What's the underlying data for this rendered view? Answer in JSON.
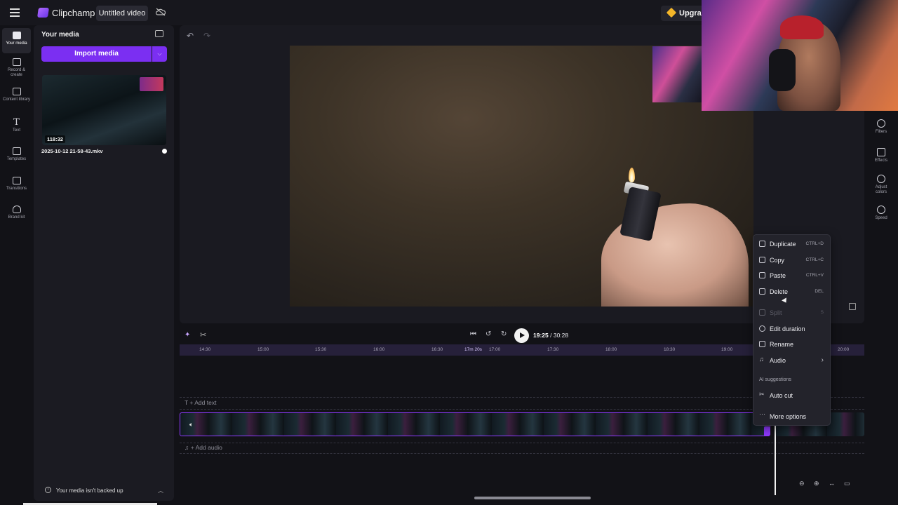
{
  "topbar": {
    "app_name": "Clipchamp",
    "project_title": "Untitled video",
    "upgrade_label": "Upgrade"
  },
  "rail": {
    "items": [
      {
        "label": "Your media",
        "icon": "folder-icon"
      },
      {
        "label": "Record & create",
        "icon": "camera-icon"
      },
      {
        "label": "Content library",
        "icon": "library-icon"
      },
      {
        "label": "Text",
        "icon": "text-icon"
      },
      {
        "label": "Templates",
        "icon": "templates-icon"
      },
      {
        "label": "Transitions",
        "icon": "transitions-icon"
      },
      {
        "label": "Brand kit",
        "icon": "brand-kit-icon"
      }
    ]
  },
  "media_panel": {
    "title": "Your media",
    "import_label": "Import media",
    "item": {
      "duration": "118:32",
      "file_name": "2025-10-12 21-58-43.mkv"
    },
    "backup_text": "Your media isn't backed up"
  },
  "right_rail": {
    "items": [
      {
        "label": "Filters",
        "icon": "filters-icon"
      },
      {
        "label": "Effects",
        "icon": "effects-icon"
      },
      {
        "label": "Adjust colors",
        "icon": "adjust-colors-icon"
      },
      {
        "label": "Speed",
        "icon": "speed-icon"
      }
    ]
  },
  "timeline": {
    "current_time": "19:25",
    "total_time": "30:28",
    "ruler_ticks": [
      "14:30",
      "15:00",
      "15:30",
      "16:00",
      "16:30",
      "17:00",
      "17:30",
      "18:00",
      "18:30",
      "19:00",
      "20:00"
    ],
    "playhead_label": "17m 20s",
    "add_text": "+ Add text",
    "add_audio": "+ Add audio"
  },
  "context_menu": {
    "items": [
      {
        "label": "Duplicate",
        "shortcut": "CTRL+D",
        "icon": "duplicate-icon",
        "enabled": true
      },
      {
        "label": "Copy",
        "shortcut": "CTRL+C",
        "icon": "copy-icon",
        "enabled": true
      },
      {
        "label": "Paste",
        "shortcut": "CTRL+V",
        "icon": "paste-icon",
        "enabled": true
      },
      {
        "label": "Delete",
        "shortcut": "DEL",
        "icon": "trash-icon",
        "enabled": true
      },
      {
        "label": "Split",
        "shortcut": "S",
        "icon": "split-icon",
        "enabled": false
      },
      {
        "label": "Edit duration",
        "shortcut": "",
        "icon": "clock-icon",
        "enabled": true
      },
      {
        "label": "Rename",
        "shortcut": "",
        "icon": "rename-icon",
        "enabled": true
      },
      {
        "label": "Audio",
        "shortcut": "",
        "icon": "music-note-icon",
        "enabled": true
      }
    ],
    "section_label": "AI suggestions",
    "auto_cut": "Auto cut",
    "more_options": "More options"
  },
  "colors": {
    "accent": "#7b2ff2",
    "panel": "#1b1b22",
    "background": "#121217"
  }
}
